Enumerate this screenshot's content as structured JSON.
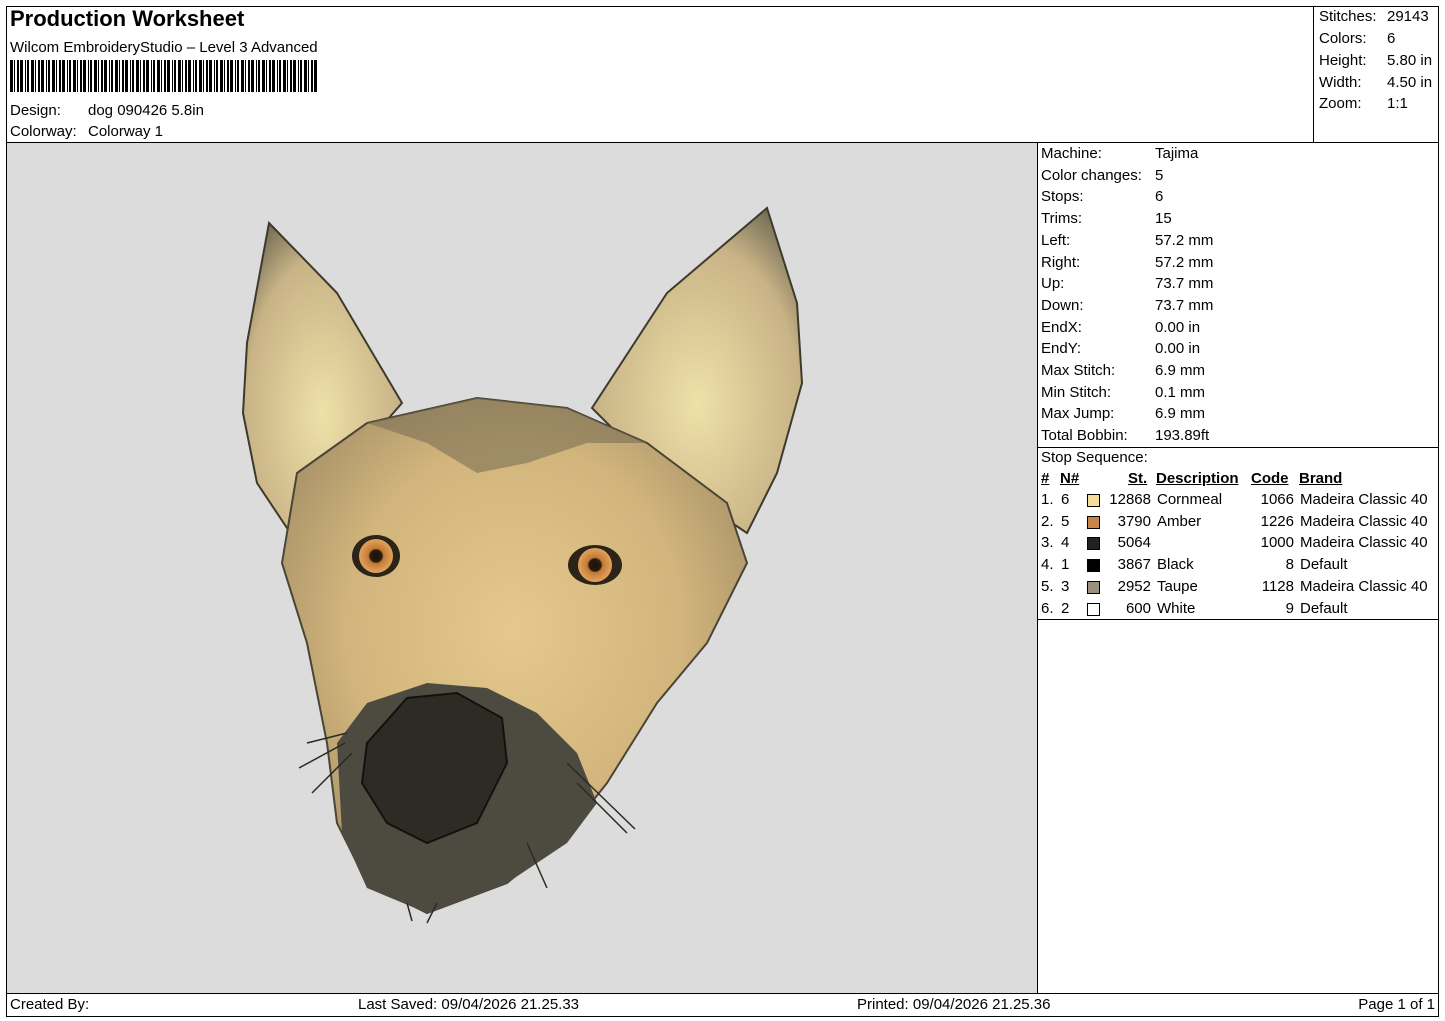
{
  "header": {
    "title": "Production Worksheet",
    "software": "Wilcom EmbroideryStudio – Level 3 Advanced",
    "design_label": "Design:",
    "design_value": "dog 090426 5.8in",
    "colorway_label": "Colorway:",
    "colorway_value": "Colorway 1"
  },
  "stats": [
    {
      "label": "Stitches:",
      "value": "29143"
    },
    {
      "label": "Colors:",
      "value": "6"
    },
    {
      "label": "Height:",
      "value": "5.80 in"
    },
    {
      "label": "Width:",
      "value": "4.50 in"
    },
    {
      "label": "Zoom:",
      "value": "1:1"
    }
  ],
  "machine_info": [
    {
      "label": "Machine:",
      "value": "Tajima"
    },
    {
      "label": "Color changes:",
      "value": "5"
    },
    {
      "label": "Stops:",
      "value": "6"
    },
    {
      "label": "Trims:",
      "value": "15"
    },
    {
      "label": "Left:",
      "value": "57.2 mm"
    },
    {
      "label": "Right:",
      "value": "57.2 mm"
    },
    {
      "label": "Up:",
      "value": "73.7 mm"
    },
    {
      "label": "Down:",
      "value": "73.7 mm"
    },
    {
      "label": "EndX:",
      "value": "0.00 in"
    },
    {
      "label": "EndY:",
      "value": "0.00 in"
    },
    {
      "label": "Max Stitch:",
      "value": "6.9 mm"
    },
    {
      "label": "Min Stitch:",
      "value": "0.1 mm"
    },
    {
      "label": "Max Jump:",
      "value": "6.9 mm"
    },
    {
      "label": "Total Bobbin:",
      "value": "193.89ft"
    }
  ],
  "stop_sequence": {
    "title": "Stop Sequence:",
    "columns": {
      "num": "#",
      "n": "N#",
      "st": "St.",
      "description": "Description",
      "code": "Code",
      "brand": "Brand"
    },
    "rows": [
      {
        "num": "1.",
        "n": "6",
        "color": "#f3dd9a",
        "st": "12868",
        "description": "Cornmeal",
        "code": "1066",
        "brand": "Madeira Classic 40"
      },
      {
        "num": "2.",
        "n": "5",
        "color": "#c9844a",
        "st": "3790",
        "description": "Amber",
        "code": "1226",
        "brand": "Madeira Classic 40"
      },
      {
        "num": "3.",
        "n": "4",
        "color": "#222222",
        "st": "5064",
        "description": "",
        "code": "1000",
        "brand": "Madeira Classic 40"
      },
      {
        "num": "4.",
        "n": "1",
        "color": "#000000",
        "st": "3867",
        "description": "Black",
        "code": "8",
        "brand": "Default"
      },
      {
        "num": "5.",
        "n": "3",
        "color": "#9c8f7c",
        "st": "2952",
        "description": "Taupe",
        "code": "1128",
        "brand": "Madeira Classic 40"
      },
      {
        "num": "6.",
        "n": "2",
        "color": "#ffffff",
        "st": "600",
        "description": "White",
        "code": "9",
        "brand": "Default"
      }
    ]
  },
  "footer": {
    "created_by": "Created By:",
    "last_saved": "Last Saved: 09/04/2026 21.25.33",
    "printed": "Printed: 09/04/2026 21.25.36",
    "page": "Page 1 of 1"
  },
  "preview": {
    "background": "#dcdcdc",
    "fur_light": "#e8d49a",
    "fur_mid": "#c9a46a",
    "fur_dark": "#3b3b30",
    "eye": "#d18a3e"
  }
}
